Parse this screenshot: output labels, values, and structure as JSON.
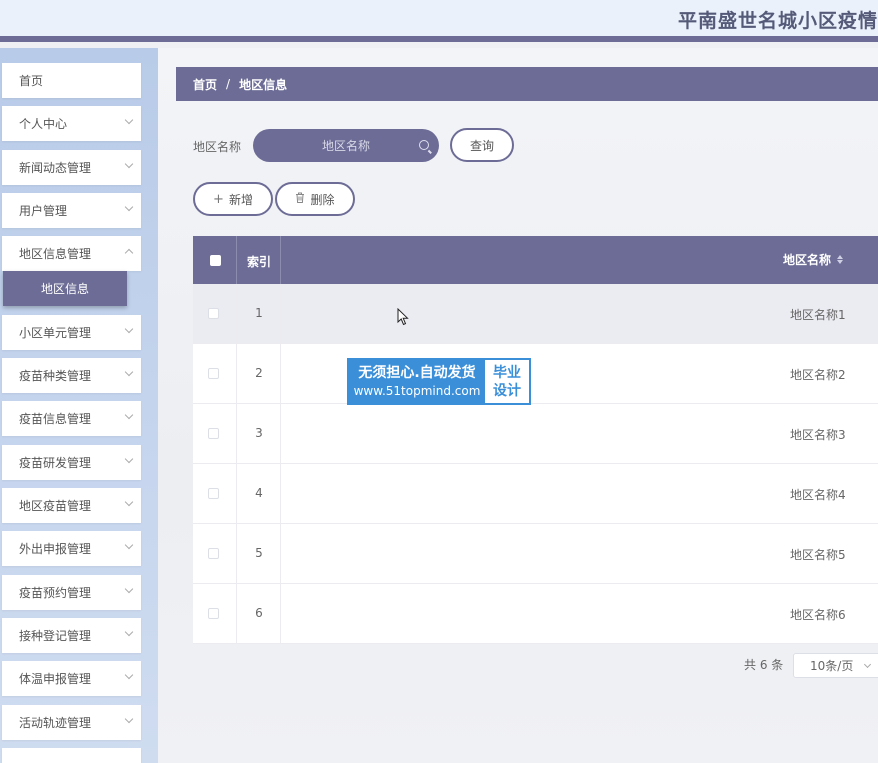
{
  "header": {
    "title": "平南盛世名城小区疫情"
  },
  "sidebar": {
    "items": [
      {
        "label": "首页"
      },
      {
        "label": "个人中心"
      },
      {
        "label": "新闻动态管理"
      },
      {
        "label": "用户管理"
      },
      {
        "label": "地区信息管理"
      },
      {
        "label": "小区单元管理"
      },
      {
        "label": "疫苗种类管理"
      },
      {
        "label": "疫苗信息管理"
      },
      {
        "label": "疫苗研发管理"
      },
      {
        "label": "地区疫苗管理"
      },
      {
        "label": "外出申报管理"
      },
      {
        "label": "疫苗预约管理"
      },
      {
        "label": "接种登记管理"
      },
      {
        "label": "体温申报管理"
      },
      {
        "label": "活动轨迹管理"
      }
    ],
    "active_sub": "地区信息"
  },
  "breadcrumb": {
    "home": "首页",
    "sep": "/",
    "current": "地区信息"
  },
  "search": {
    "label": "地区名称",
    "placeholder": "地区名称",
    "query_label": "查询"
  },
  "toolbar": {
    "add_label": "新增",
    "delete_label": "删除"
  },
  "table": {
    "headers": {
      "index": "索引",
      "name": "地区名称"
    },
    "rows": [
      {
        "index": "1",
        "name": "地区名称1"
      },
      {
        "index": "2",
        "name": "地区名称2"
      },
      {
        "index": "3",
        "name": "地区名称3"
      },
      {
        "index": "4",
        "name": "地区名称4"
      },
      {
        "index": "5",
        "name": "地区名称5"
      },
      {
        "index": "6",
        "name": "地区名称6"
      }
    ]
  },
  "pagination": {
    "total": "共 6 条",
    "page_size": "10条/页"
  },
  "watermark": {
    "line1": "无须担心.自动发货",
    "line2": "www.51topmind.com",
    "right1": "毕业",
    "right2": "设计"
  },
  "colors": {
    "accent": "#6c6c96",
    "sidebar_bg": "#c1d2ec",
    "watermark_blue": "#3a8fd8"
  }
}
